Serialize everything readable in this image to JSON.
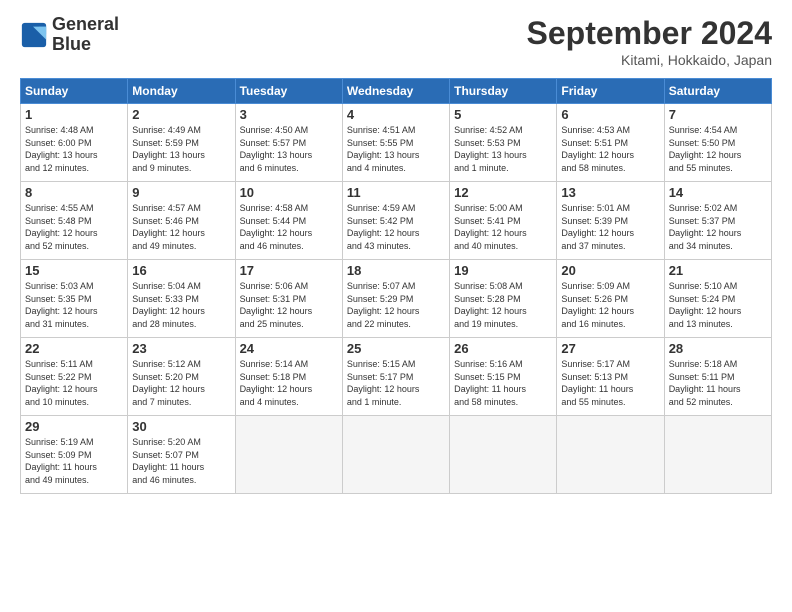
{
  "header": {
    "logo_line1": "General",
    "logo_line2": "Blue",
    "month": "September 2024",
    "location": "Kitami, Hokkaido, Japan"
  },
  "days_of_week": [
    "Sunday",
    "Monday",
    "Tuesday",
    "Wednesday",
    "Thursday",
    "Friday",
    "Saturday"
  ],
  "weeks": [
    [
      {
        "day": 1,
        "lines": [
          "Sunrise: 4:48 AM",
          "Sunset: 6:00 PM",
          "Daylight: 13 hours",
          "and 12 minutes."
        ]
      },
      {
        "day": 2,
        "lines": [
          "Sunrise: 4:49 AM",
          "Sunset: 5:59 PM",
          "Daylight: 13 hours",
          "and 9 minutes."
        ]
      },
      {
        "day": 3,
        "lines": [
          "Sunrise: 4:50 AM",
          "Sunset: 5:57 PM",
          "Daylight: 13 hours",
          "and 6 minutes."
        ]
      },
      {
        "day": 4,
        "lines": [
          "Sunrise: 4:51 AM",
          "Sunset: 5:55 PM",
          "Daylight: 13 hours",
          "and 4 minutes."
        ]
      },
      {
        "day": 5,
        "lines": [
          "Sunrise: 4:52 AM",
          "Sunset: 5:53 PM",
          "Daylight: 13 hours",
          "and 1 minute."
        ]
      },
      {
        "day": 6,
        "lines": [
          "Sunrise: 4:53 AM",
          "Sunset: 5:51 PM",
          "Daylight: 12 hours",
          "and 58 minutes."
        ]
      },
      {
        "day": 7,
        "lines": [
          "Sunrise: 4:54 AM",
          "Sunset: 5:50 PM",
          "Daylight: 12 hours",
          "and 55 minutes."
        ]
      }
    ],
    [
      {
        "day": 8,
        "lines": [
          "Sunrise: 4:55 AM",
          "Sunset: 5:48 PM",
          "Daylight: 12 hours",
          "and 52 minutes."
        ]
      },
      {
        "day": 9,
        "lines": [
          "Sunrise: 4:57 AM",
          "Sunset: 5:46 PM",
          "Daylight: 12 hours",
          "and 49 minutes."
        ]
      },
      {
        "day": 10,
        "lines": [
          "Sunrise: 4:58 AM",
          "Sunset: 5:44 PM",
          "Daylight: 12 hours",
          "and 46 minutes."
        ]
      },
      {
        "day": 11,
        "lines": [
          "Sunrise: 4:59 AM",
          "Sunset: 5:42 PM",
          "Daylight: 12 hours",
          "and 43 minutes."
        ]
      },
      {
        "day": 12,
        "lines": [
          "Sunrise: 5:00 AM",
          "Sunset: 5:41 PM",
          "Daylight: 12 hours",
          "and 40 minutes."
        ]
      },
      {
        "day": 13,
        "lines": [
          "Sunrise: 5:01 AM",
          "Sunset: 5:39 PM",
          "Daylight: 12 hours",
          "and 37 minutes."
        ]
      },
      {
        "day": 14,
        "lines": [
          "Sunrise: 5:02 AM",
          "Sunset: 5:37 PM",
          "Daylight: 12 hours",
          "and 34 minutes."
        ]
      }
    ],
    [
      {
        "day": 15,
        "lines": [
          "Sunrise: 5:03 AM",
          "Sunset: 5:35 PM",
          "Daylight: 12 hours",
          "and 31 minutes."
        ]
      },
      {
        "day": 16,
        "lines": [
          "Sunrise: 5:04 AM",
          "Sunset: 5:33 PM",
          "Daylight: 12 hours",
          "and 28 minutes."
        ]
      },
      {
        "day": 17,
        "lines": [
          "Sunrise: 5:06 AM",
          "Sunset: 5:31 PM",
          "Daylight: 12 hours",
          "and 25 minutes."
        ]
      },
      {
        "day": 18,
        "lines": [
          "Sunrise: 5:07 AM",
          "Sunset: 5:29 PM",
          "Daylight: 12 hours",
          "and 22 minutes."
        ]
      },
      {
        "day": 19,
        "lines": [
          "Sunrise: 5:08 AM",
          "Sunset: 5:28 PM",
          "Daylight: 12 hours",
          "and 19 minutes."
        ]
      },
      {
        "day": 20,
        "lines": [
          "Sunrise: 5:09 AM",
          "Sunset: 5:26 PM",
          "Daylight: 12 hours",
          "and 16 minutes."
        ]
      },
      {
        "day": 21,
        "lines": [
          "Sunrise: 5:10 AM",
          "Sunset: 5:24 PM",
          "Daylight: 12 hours",
          "and 13 minutes."
        ]
      }
    ],
    [
      {
        "day": 22,
        "lines": [
          "Sunrise: 5:11 AM",
          "Sunset: 5:22 PM",
          "Daylight: 12 hours",
          "and 10 minutes."
        ]
      },
      {
        "day": 23,
        "lines": [
          "Sunrise: 5:12 AM",
          "Sunset: 5:20 PM",
          "Daylight: 12 hours",
          "and 7 minutes."
        ]
      },
      {
        "day": 24,
        "lines": [
          "Sunrise: 5:14 AM",
          "Sunset: 5:18 PM",
          "Daylight: 12 hours",
          "and 4 minutes."
        ]
      },
      {
        "day": 25,
        "lines": [
          "Sunrise: 5:15 AM",
          "Sunset: 5:17 PM",
          "Daylight: 12 hours",
          "and 1 minute."
        ]
      },
      {
        "day": 26,
        "lines": [
          "Sunrise: 5:16 AM",
          "Sunset: 5:15 PM",
          "Daylight: 11 hours",
          "and 58 minutes."
        ]
      },
      {
        "day": 27,
        "lines": [
          "Sunrise: 5:17 AM",
          "Sunset: 5:13 PM",
          "Daylight: 11 hours",
          "and 55 minutes."
        ]
      },
      {
        "day": 28,
        "lines": [
          "Sunrise: 5:18 AM",
          "Sunset: 5:11 PM",
          "Daylight: 11 hours",
          "and 52 minutes."
        ]
      }
    ],
    [
      {
        "day": 29,
        "lines": [
          "Sunrise: 5:19 AM",
          "Sunset: 5:09 PM",
          "Daylight: 11 hours",
          "and 49 minutes."
        ]
      },
      {
        "day": 30,
        "lines": [
          "Sunrise: 5:20 AM",
          "Sunset: 5:07 PM",
          "Daylight: 11 hours",
          "and 46 minutes."
        ]
      },
      null,
      null,
      null,
      null,
      null
    ]
  ]
}
